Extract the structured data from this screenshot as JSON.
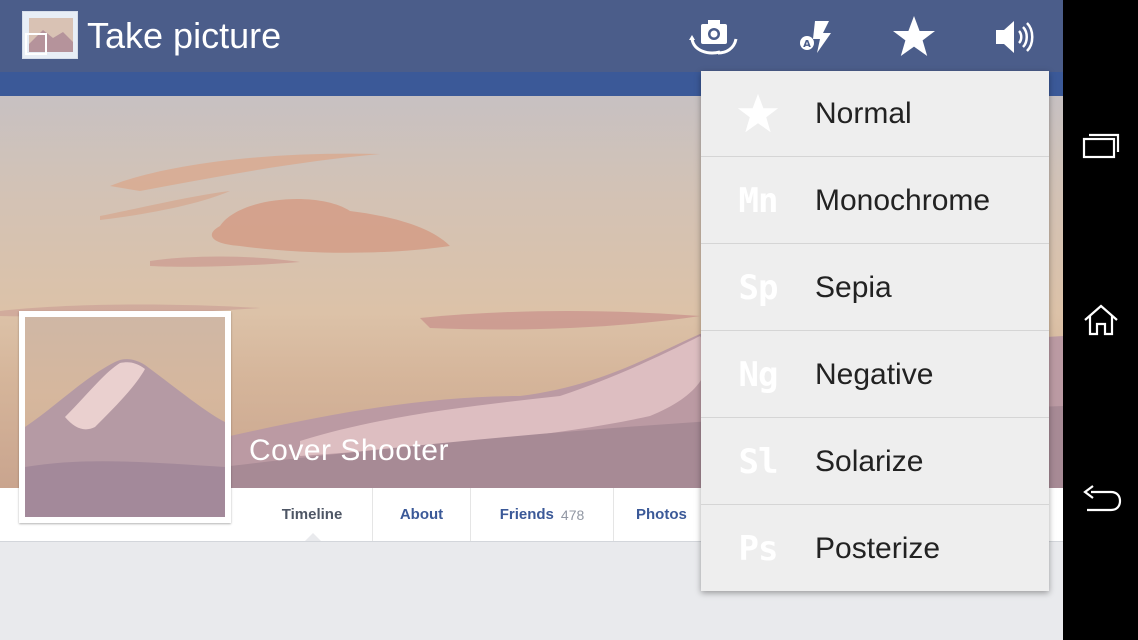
{
  "action_bar": {
    "title": "Take picture",
    "icons": [
      "switch-camera-icon",
      "flash-auto-icon",
      "effects-star-icon",
      "volume-icon"
    ]
  },
  "profile": {
    "name": "Cover Shooter"
  },
  "tabs": [
    {
      "label": "Timeline",
      "active": true
    },
    {
      "label": "About"
    },
    {
      "label": "Friends",
      "count": "478"
    },
    {
      "label": "Photos"
    }
  ],
  "menu": {
    "items": [
      {
        "abbr": "",
        "icon": "star-icon",
        "label": "Normal"
      },
      {
        "abbr": "Mn",
        "label": "Monochrome"
      },
      {
        "abbr": "Sp",
        "label": "Sepia"
      },
      {
        "abbr": "Ng",
        "label": "Negative"
      },
      {
        "abbr": "Sl",
        "label": "Solarize"
      },
      {
        "abbr": "Ps",
        "label": "Posterize"
      }
    ]
  },
  "nav": {
    "icons": [
      "recent-apps-icon",
      "home-icon",
      "back-icon"
    ]
  },
  "colors": {
    "action_bar": "#4b5d8a",
    "facebook_blue": "#3b5998",
    "menu_bg": "#eeeeee",
    "nav_bar": "#000000"
  }
}
